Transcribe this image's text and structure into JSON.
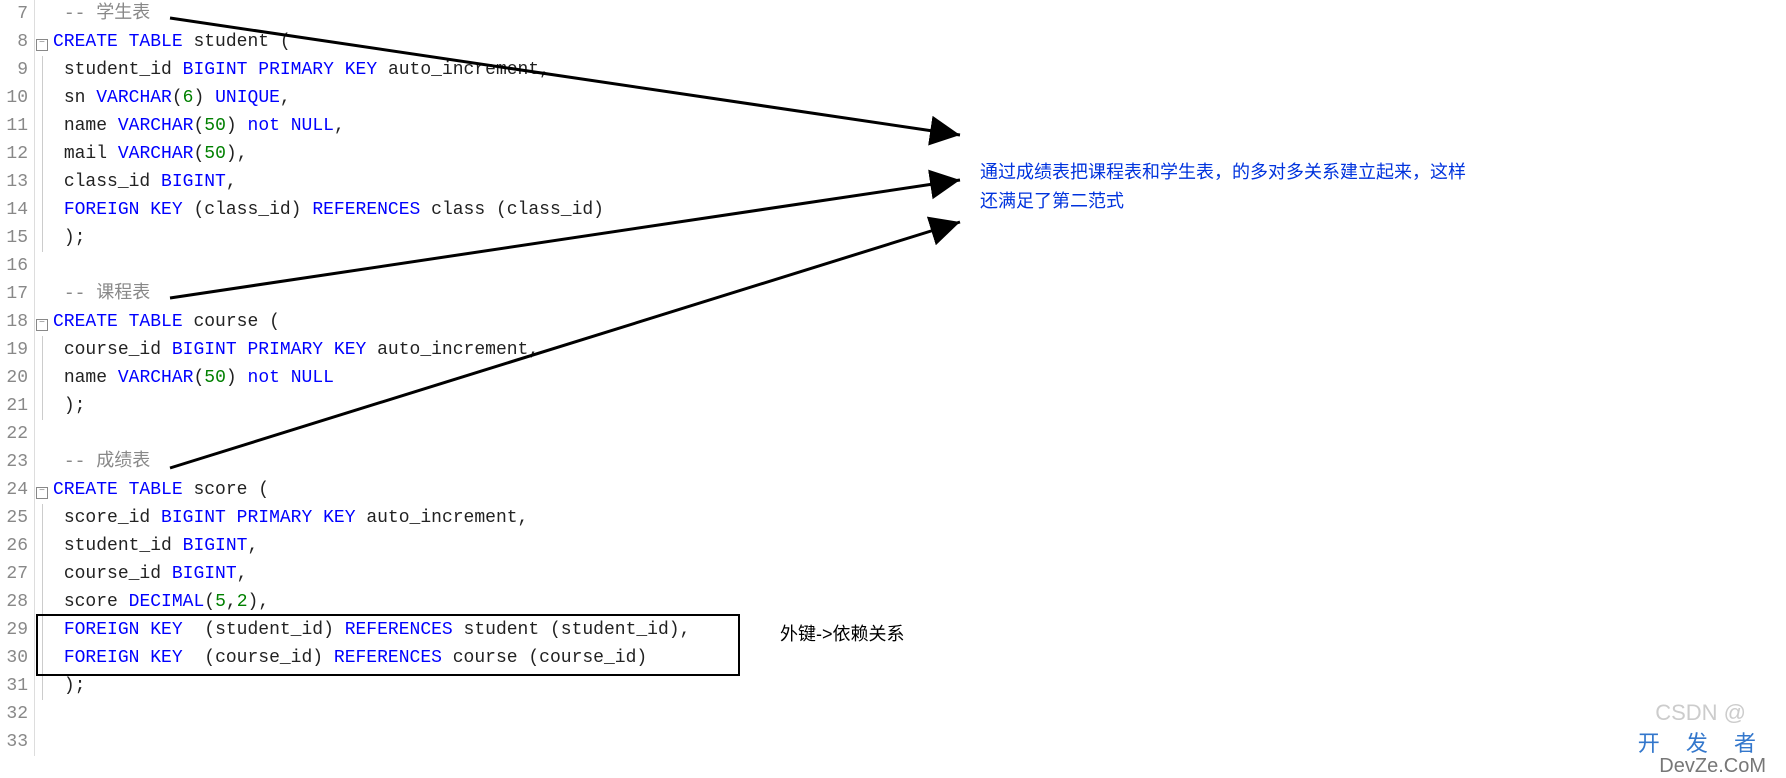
{
  "lines": {
    "7": {
      "n": "7",
      "fold": "",
      "html": " <span class='cmt'>-- 学生表</span>"
    },
    "8": {
      "n": "8",
      "fold": "box",
      "html": "<span class='kw'>CREATE</span> <span class='kw'>TABLE</span> <span class='txt'>student (</span>"
    },
    "9": {
      "n": "9",
      "fold": "line",
      "html": " <span class='txt'>student_id</span> <span class='kw'>BIGINT</span> <span class='kw'>PRIMARY</span> <span class='kw'>KEY</span> <span class='txt'>auto_increment,</span>"
    },
    "10": {
      "n": "10",
      "fold": "line",
      "html": " <span class='txt'>sn</span> <span class='kw'>VARCHAR</span><span class='txt'>(</span><span class='num'>6</span><span class='txt'>)</span> <span class='kw'>UNIQUE</span><span class='txt'>,</span>"
    },
    "11": {
      "n": "11",
      "fold": "line",
      "html": " <span class='txt'>name</span> <span class='kw'>VARCHAR</span><span class='txt'>(</span><span class='num'>50</span><span class='txt'>)</span> <span class='kw'>not</span> <span class='kw'>NULL</span><span class='txt'>,</span>"
    },
    "12": {
      "n": "12",
      "fold": "line",
      "html": " <span class='txt'>mail</span> <span class='kw'>VARCHAR</span><span class='txt'>(</span><span class='num'>50</span><span class='txt'>),</span>"
    },
    "13": {
      "n": "13",
      "fold": "line",
      "html": " <span class='txt'>class_id</span> <span class='kw'>BIGINT</span><span class='txt'>,</span>"
    },
    "14": {
      "n": "14",
      "fold": "line",
      "html": " <span class='kw'>FOREIGN</span> <span class='kw'>KEY</span> <span class='txt'>(class_id)</span> <span class='kw'>REFERENCES</span> <span class='txt'>class (class_id)</span>"
    },
    "15": {
      "n": "15",
      "fold": "end",
      "html": " <span class='txt'>);</span>"
    },
    "16": {
      "n": "16",
      "fold": "",
      "html": ""
    },
    "17": {
      "n": "17",
      "fold": "",
      "html": " <span class='cmt'>-- 课程表</span>"
    },
    "18": {
      "n": "18",
      "fold": "box",
      "html": "<span class='kw'>CREATE</span> <span class='kw'>TABLE</span> <span class='txt'>course (</span>"
    },
    "19": {
      "n": "19",
      "fold": "line",
      "html": " <span class='txt'>course_id</span> <span class='kw'>BIGINT</span> <span class='kw'>PRIMARY</span> <span class='kw'>KEY</span> <span class='txt'>auto_increment,</span>"
    },
    "20": {
      "n": "20",
      "fold": "line",
      "html": " <span class='txt'>name</span> <span class='kw'>VARCHAR</span><span class='txt'>(</span><span class='num'>50</span><span class='txt'>)</span> <span class='kw'>not</span> <span class='kw'>NULL</span>"
    },
    "21": {
      "n": "21",
      "fold": "end",
      "html": " <span class='txt'>);</span>"
    },
    "22": {
      "n": "22",
      "fold": "",
      "html": ""
    },
    "23": {
      "n": "23",
      "fold": "",
      "html": " <span class='cmt'>-- 成绩表</span>"
    },
    "24": {
      "n": "24",
      "fold": "box",
      "html": "<span class='kw'>CREATE</span> <span class='kw'>TABLE</span> <span class='txt'>score (</span>"
    },
    "25": {
      "n": "25",
      "fold": "line",
      "html": " <span class='txt'>score_id</span> <span class='kw'>BIGINT</span> <span class='kw'>PRIMARY</span> <span class='kw'>KEY</span> <span class='txt'>auto_increment,</span>"
    },
    "26": {
      "n": "26",
      "fold": "line",
      "html": " <span class='txt'>student_id</span> <span class='kw'>BIGINT</span><span class='txt'>,</span>"
    },
    "27": {
      "n": "27",
      "fold": "line",
      "html": " <span class='txt'>course_id</span> <span class='kw'>BIGINT</span><span class='txt'>,</span>"
    },
    "28": {
      "n": "28",
      "fold": "line",
      "html": " <span class='txt'>score</span> <span class='kw'>DECIMAL</span><span class='txt'>(</span><span class='num'>5</span><span class='txt'>,</span><span class='num'>2</span><span class='txt'>),</span>"
    },
    "29": {
      "n": "29",
      "fold": "line",
      "html": " <span class='kw'>FOREIGN</span> <span class='kw'>KEY</span>  <span class='txt'>(student_id)</span> <span class='kw'>REFERENCES</span> <span class='txt'>student (student_id),</span>"
    },
    "30": {
      "n": "30",
      "fold": "line",
      "html": " <span class='kw'>FOREIGN</span> <span class='kw'>KEY</span>  <span class='txt'>(course_id)</span> <span class='kw'>REFERENCES</span> <span class='txt'>course (course_id)</span>"
    },
    "31": {
      "n": "31",
      "fold": "end",
      "html": " <span class='txt'>);</span>"
    },
    "32": {
      "n": "32",
      "fold": "",
      "html": ""
    },
    "33": {
      "n": "33",
      "fold": "",
      "html": ""
    }
  },
  "order": [
    "7",
    "8",
    "9",
    "10",
    "11",
    "12",
    "13",
    "14",
    "15",
    "16",
    "17",
    "18",
    "19",
    "20",
    "21",
    "22",
    "23",
    "24",
    "25",
    "26",
    "27",
    "28",
    "29",
    "30",
    "31",
    "32",
    "33"
  ],
  "annotation": "通过成绩表把课程表和学生表，的多对多关系建立起来，这样还满足了第二范式",
  "label_fk": "外键->依赖关系",
  "watermark_csdn": "CSDN @",
  "watermark_brand": "开 发 者",
  "watermark_domain": "DevZe.CoM"
}
